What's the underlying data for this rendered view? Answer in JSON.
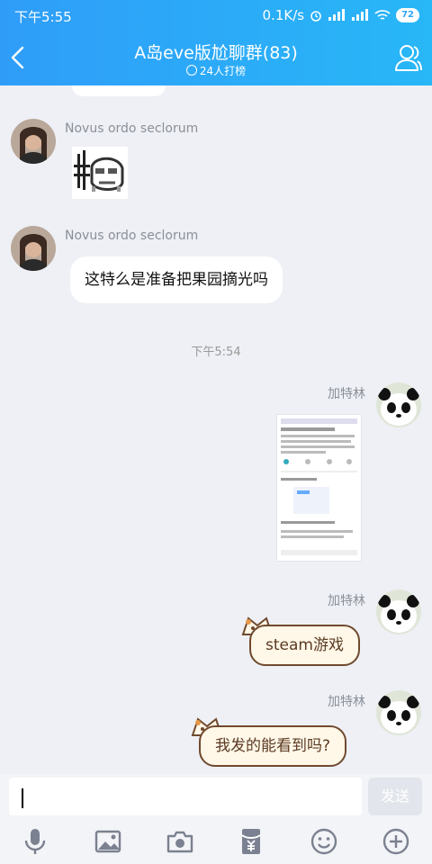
{
  "status": {
    "time": "下午5:55",
    "speed": "0.1K/s",
    "battery": "72"
  },
  "header": {
    "title": "A岛eve版尬聊群(83)",
    "subtitle": "24人打榜"
  },
  "messages": {
    "m1": {
      "sender": "Novus ordo seclorum"
    },
    "m2": {
      "sender": "Novus ordo seclorum",
      "text": "这特么是准备把果园摘光吗"
    },
    "timestamp": "下午5:54",
    "m3": {
      "sender": "加特林"
    },
    "m4": {
      "sender": "加特林",
      "text": "steam游戏"
    },
    "m5": {
      "sender": "加特林",
      "text": "我发的能看到吗?"
    }
  },
  "input": {
    "send_label": "发送"
  },
  "colors": {
    "header": "#2ea6f7",
    "background": "#eef0f5",
    "bubble_border": "#6f4a2e"
  },
  "icons": [
    "back-icon",
    "group-members-icon",
    "mic-icon",
    "image-icon",
    "camera-icon",
    "red-packet-icon",
    "emoji-icon",
    "plus-icon"
  ]
}
